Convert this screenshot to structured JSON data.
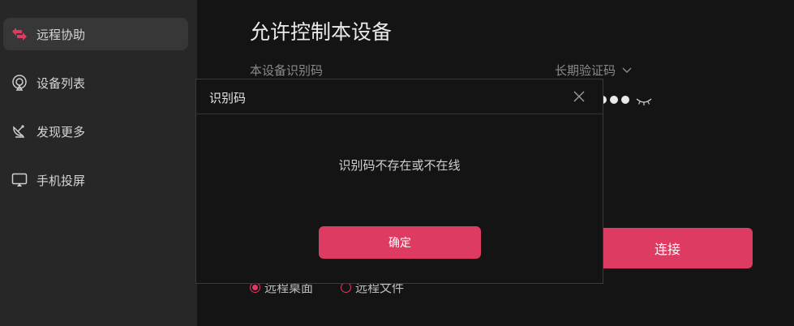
{
  "sidebar": {
    "items": [
      {
        "label": "远程协助",
        "icon": "remote-assist-icon",
        "active": true
      },
      {
        "label": "设备列表",
        "icon": "device-list-icon",
        "active": false
      },
      {
        "label": "发现更多",
        "icon": "satellite-dish-icon",
        "active": false
      },
      {
        "label": "手机投屏",
        "icon": "screen-cast-icon",
        "active": false
      }
    ]
  },
  "main": {
    "title": "允许控制本设备",
    "device_id_label": "本设备识别码",
    "code_type": "长期验证码",
    "connect_label": "连接",
    "radio_options": [
      {
        "label": "远程桌面",
        "selected": true
      },
      {
        "label": "远程文件",
        "selected": false
      }
    ]
  },
  "modal": {
    "title": "识别码",
    "message": "识别码不存在或不在线",
    "confirm_label": "确定"
  },
  "colors": {
    "accent": "#dd3b62",
    "sidebar_bg": "#272727",
    "sidebar_active_bg": "#373737",
    "main_bg": "#141414"
  }
}
